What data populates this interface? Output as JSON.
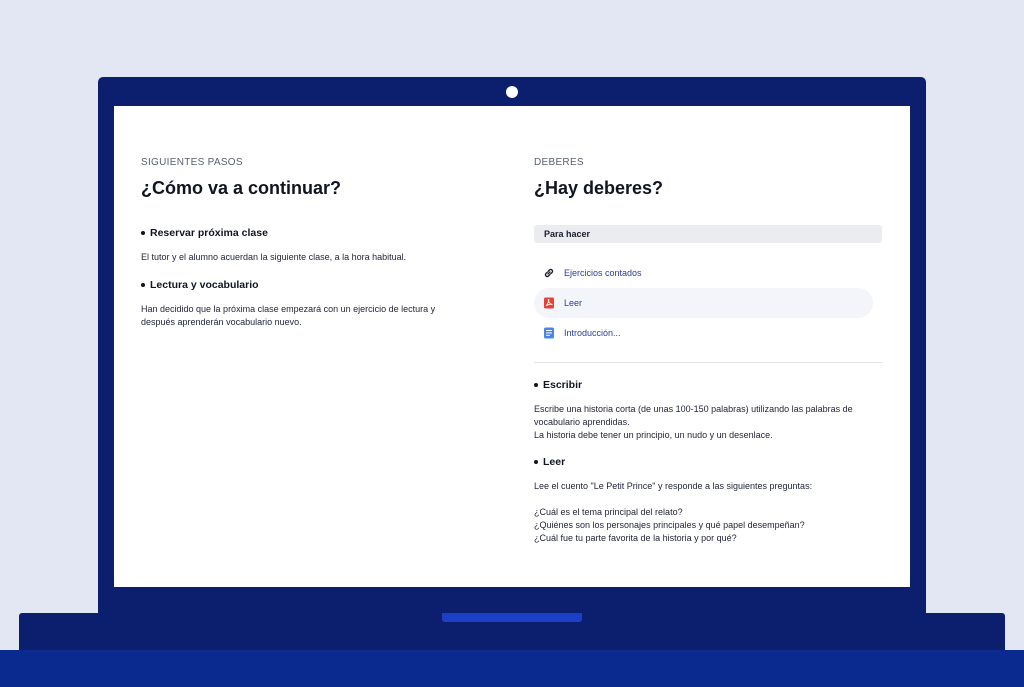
{
  "left": {
    "eyebrow": "SIGUIENTES PASOS",
    "title": "¿Cómo va a continuar?",
    "items": [
      {
        "title": "Reservar próxima clase",
        "text": "El tutor y el alumno acuerdan la siguiente clase, a la hora habitual."
      },
      {
        "title": "Lectura y vocabulario",
        "text": "Han decidido que la próxima clase empezará con un ejercicio de lectura y\ndespués aprenderán vocabulario nuevo."
      }
    ]
  },
  "right": {
    "eyebrow": "DEBERES",
    "title": "¿Hay deberes?",
    "todo_label": "Para hacer",
    "attachments": [
      {
        "label": "Ejercicios contados",
        "icon": "link-icon"
      },
      {
        "label": "Leer",
        "icon": "pdf-icon"
      },
      {
        "label": "Introducción...",
        "icon": "document-icon"
      }
    ],
    "tasks": [
      {
        "title": "Escribir",
        "text": "Escribe una historia corta (de unas 100-150 palabras) utilizando las palabras de\nvocabulario aprendidas.\nLa historia debe tener un principio, un nudo y un desenlace."
      },
      {
        "title": "Leer",
        "text": "Lee el cuento \"Le Petit Prince\" y responde a las siguientes preguntas:\n\n¿Cuál es el tema principal del relato?\n¿Quiénes son los personajes principales y qué papel desempeñan?\n¿Cuál fue tu parte favorita de la historia y por qué?"
      }
    ]
  },
  "colors": {
    "laptop": "#0b1f6e",
    "desk": "#0b2a8f",
    "trackpad": "#1c3fc7",
    "background": "#e3e7f4",
    "link": "#2a3f9a",
    "pdf": "#e5433a",
    "doc": "#4a84e6"
  }
}
